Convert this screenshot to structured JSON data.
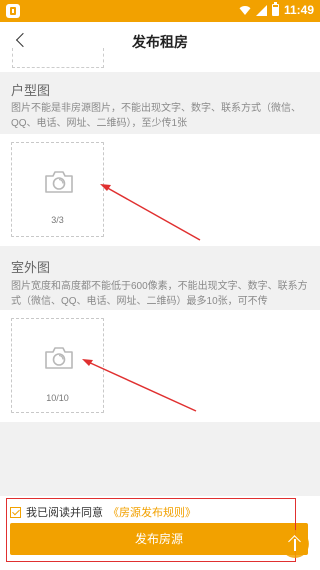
{
  "status_bar": {
    "time": "11:49"
  },
  "header": {
    "title": "发布租房"
  },
  "layout_section": {
    "title": "户型图",
    "description": "图片不能是非房源图片，不能出现文字、数字、联系方式（微信、QQ、电话、网址、二维码），至少传1张",
    "count": "3/3"
  },
  "exterior_section": {
    "title": "室外图",
    "description": "图片宽度和高度都不能低于600像素，不能出现文字、数字、联系方式（微信、QQ、电话、网址、二维码）最多10张，可不传",
    "count": "10/10"
  },
  "footer": {
    "agree_prefix": "我已阅读并同意",
    "rules_link": "《房源发布规则》",
    "publish_button": "发布房源",
    "agree_checked": true
  },
  "colors": {
    "accent": "#f2a100",
    "annotation": "#e03030"
  },
  "icons": [
    "back-icon",
    "camera-icon",
    "wifi-icon",
    "signal-icon",
    "battery-icon",
    "scroll-top-icon"
  ]
}
